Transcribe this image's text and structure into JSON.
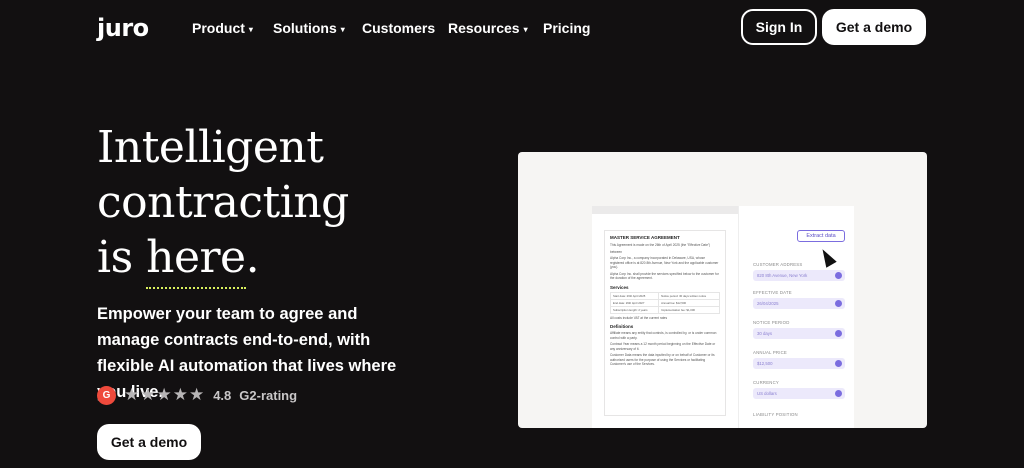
{
  "brand": {
    "logo": "juro"
  },
  "nav": {
    "items": [
      {
        "label": "Product",
        "has_dropdown": true
      },
      {
        "label": "Solutions",
        "has_dropdown": true
      },
      {
        "label": "Customers",
        "has_dropdown": false
      },
      {
        "label": "Resources",
        "has_dropdown": true
      },
      {
        "label": "Pricing",
        "has_dropdown": false
      }
    ],
    "signin_label": "Sign In",
    "demo_label": "Get a demo",
    "caret": "▾"
  },
  "hero": {
    "title_line1": "Intelligent",
    "title_line2": "contracting",
    "title_line3_a": "is ",
    "title_line3_b": "here",
    "title_line3_c": ".",
    "subtitle": "Empower your team to agree and manage contracts end-to-end, with flexible AI automation that lives where you live.",
    "rating_stars": "★★★★★",
    "rating_score": "4.8",
    "rating_label": "G2-rating",
    "g2_badge": "G",
    "cta_label": "Get a demo"
  },
  "mock": {
    "doc_title": "MASTER SERVICE AGREEMENT",
    "doc_p1": "This Agreement is made on the 26th of April 2025 (the \"Effective Date\")",
    "doc_between": "between",
    "doc_p2": "Alpha Corp Inc., a company incorporated in Delaware, USA, whose registered office is at 820 8th Avenue, New York and the applicable customer (you).",
    "doc_p3": "Alpha Corp Inc. shall provide the services specified below to the customer for the duration of the agreement.",
    "doc_services": "Services",
    "doc_table": [
      [
        "Start date: 26th April 2025",
        "Notice period: 30 days written notice"
      ],
      [
        "End date: 29th April 2027",
        "Annual fee: $12,500"
      ],
      [
        "Subscription length: 2 years",
        "Implementation fee: $1,000"
      ]
    ],
    "doc_table_note": "All costs include VAT at the current rates",
    "doc_definitions": "Definitions",
    "doc_d1": "Affiliate means any entity that controls, is controlled by, or is under common control with a party.",
    "doc_d2": "Contract Year means a 12 month period beginning on the Effective Date or any anniversary of it.",
    "doc_d3": "Customer Data means the data inputted by or on behalf of Customer or its authorised users for the purpose of using the Services or facilitating Customer's use of the Services.",
    "extract_label": "Extract data",
    "fields": [
      {
        "label": "CUSTOMER ADDRESS",
        "value": "820 8th Avenue, New York"
      },
      {
        "label": "EFFECTIVE DATE",
        "value": "26/04/2025"
      },
      {
        "label": "NOTICE PERIOD",
        "value": "30 days"
      },
      {
        "label": "ANNUAL PRICE",
        "value": "$12,500"
      },
      {
        "label": "CURRENCY",
        "value": "US dollars"
      },
      {
        "label": "LIABILITY POSITION",
        "value": ""
      }
    ]
  }
}
